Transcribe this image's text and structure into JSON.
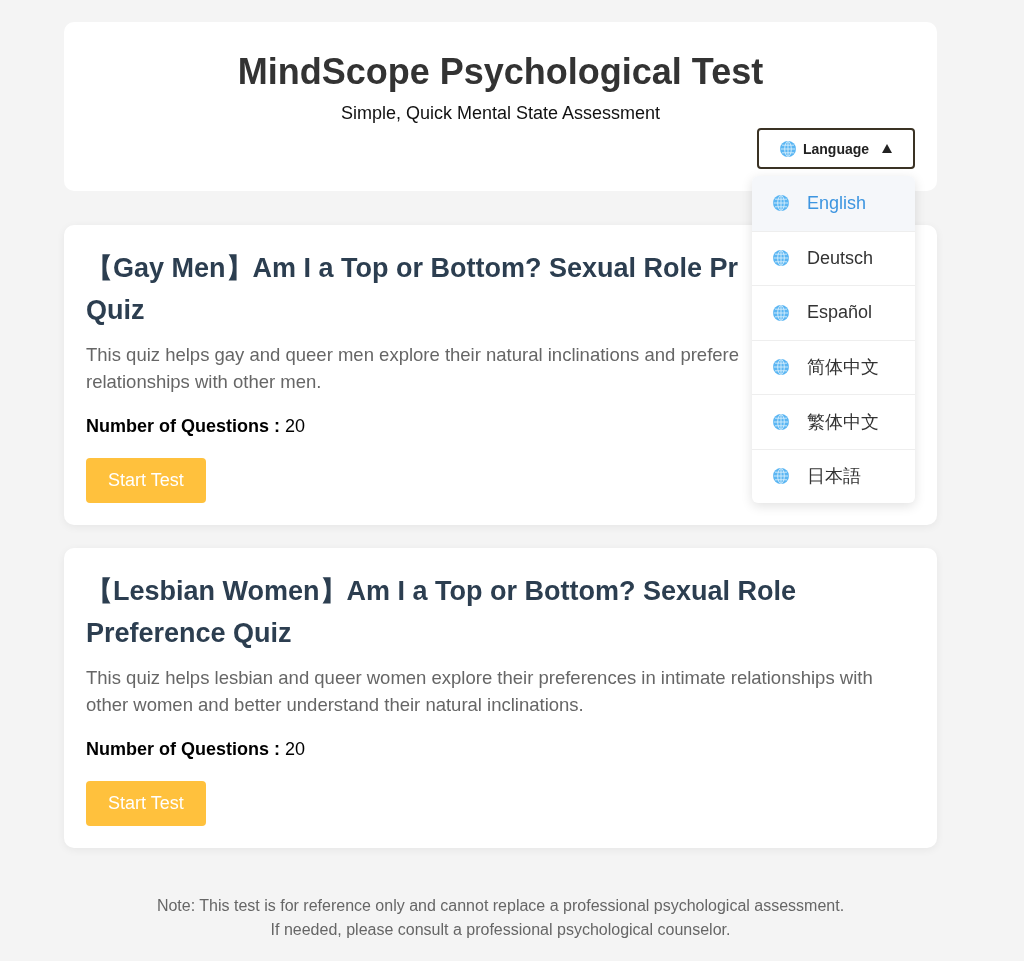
{
  "header": {
    "title": "MindScope Psychological Test",
    "subtitle": "Simple, Quick Mental State Assessment",
    "language_button": {
      "label": "Language",
      "expanded": true
    }
  },
  "language_menu": {
    "items": [
      {
        "label": "English",
        "selected": true
      },
      {
        "label": "Deutsch",
        "selected": false
      },
      {
        "label": "Español",
        "selected": false
      },
      {
        "label": "简体中文",
        "selected": false
      },
      {
        "label": "繁体中文",
        "selected": false
      },
      {
        "label": "日本語",
        "selected": false
      }
    ]
  },
  "quizzes": [
    {
      "title_lines": [
        "【Gay Men】Am I a Top or Bottom? Sexual Role Pr",
        "Quiz"
      ],
      "description_lines": [
        "This quiz helps gay and queer men explore their natural inclinations and prefere",
        "relationships with other men."
      ],
      "question_count": "**Number of Questions :** 20",
      "button": "Start Test"
    },
    {
      "title_lines": [
        "【Lesbian Women】Am I a Top or Bottom? Sexual Role",
        "Preference Quiz"
      ],
      "description_lines": [
        "This quiz helps lesbian and queer women explore their preferences in intimate relationships with",
        "other women and better understand their natural inclinations."
      ],
      "question_count": "**Number of Questions :** 20",
      "button": "Start Test"
    }
  ],
  "footer_note": [
    "Note: This test is for reference only and cannot replace a professional psychological assessment.",
    "If needed, please consult a professional psychological counselor."
  ]
}
